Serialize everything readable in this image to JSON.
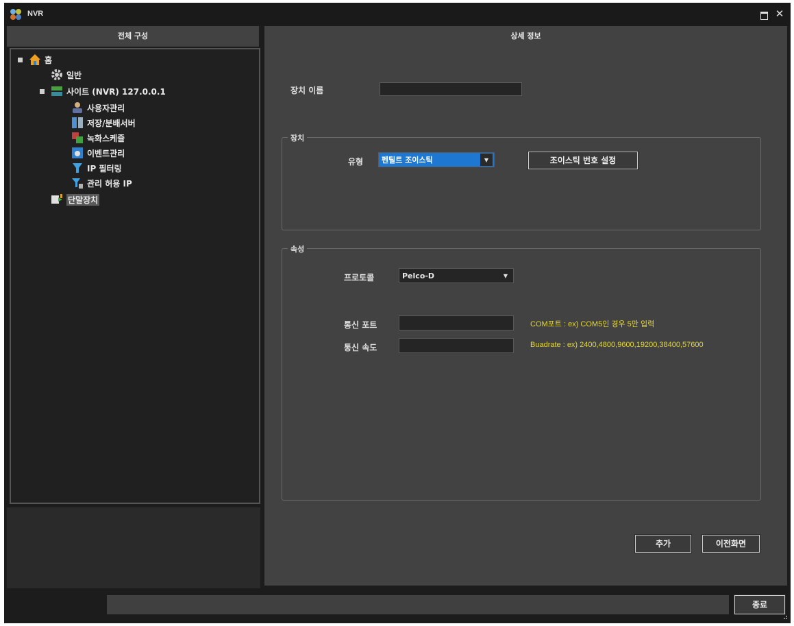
{
  "window": {
    "title": "NVR"
  },
  "left_panel": {
    "header": "전체 구성"
  },
  "right_panel": {
    "header": "상세 정보"
  },
  "tree": {
    "home": "홈",
    "general": "일반",
    "site": "사이트 (NVR) 127.0.0.1",
    "user_mgmt": "사용자관리",
    "storage": "저장/분배서버",
    "rec_schedule": "녹화스케쥴",
    "event_mgmt": "이벤트관리",
    "ip_filter": "IP 필터링",
    "allowed_ip": "관리 허용 IP",
    "terminal": "단말장치"
  },
  "form": {
    "device_name_label": "장치 이름",
    "device_name_value": "",
    "device_group": "장치",
    "type_label": "유형",
    "type_value": "펜틸트 조이스틱",
    "joystick_button": "조이스틱 번호 설정",
    "props_group": "속성",
    "protocol_label": "프로토콜",
    "protocol_value": "Pelco-D",
    "port_label": "통신 포트",
    "port_value": "",
    "port_hint": "COM포트 : ex) COM5인 경우 5만 입력",
    "speed_label": "통신 속도",
    "speed_value": "",
    "speed_hint": "Buadrate : ex) 2400,4800,9600,19200,38400,57600"
  },
  "buttons": {
    "add": "추가",
    "previous": "이전화면",
    "close": "종료"
  },
  "colors": {
    "hint": "#e6d836",
    "selected_combo": "#1e78d2"
  }
}
